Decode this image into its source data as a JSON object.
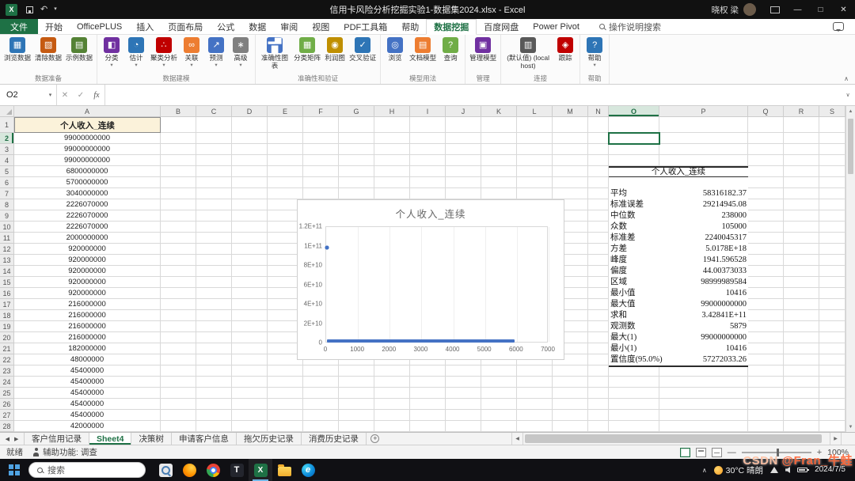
{
  "title_bar": {
    "title": "信用卡风险分析挖掘实验1-数据集2024.xlsx - Excel",
    "user": "晓权 梁"
  },
  "icons": {
    "excel": "X",
    "undo": "↶",
    "dropdown": "▾",
    "minimize": "—",
    "maximize": "□",
    "close": "✕",
    "collapse_ribbon": "∧",
    "expand_formula": "∨",
    "sheet_prev": "◀",
    "sheet_next": "▶",
    "scroll_up": "▲",
    "scroll_down": "▼",
    "scroll_left": "◀",
    "scroll_right": "▶",
    "add_sheet": "+",
    "tray_expand": "∧",
    "zoom_out": "—",
    "zoom_in": "+",
    "t_app": "T",
    "edge": "e"
  },
  "ribbon": {
    "search_placeholder": "操作说明搜索",
    "tabs": [
      {
        "label": "文件",
        "file": true
      },
      {
        "label": "开始"
      },
      {
        "label": "OfficePLUS"
      },
      {
        "label": "插入"
      },
      {
        "label": "页面布局"
      },
      {
        "label": "公式"
      },
      {
        "label": "数据"
      },
      {
        "label": "审阅"
      },
      {
        "label": "视图"
      },
      {
        "label": "PDF工具箱"
      },
      {
        "label": "帮助"
      },
      {
        "label": "数据挖掘",
        "active": true
      },
      {
        "label": "百度网盘"
      },
      {
        "label": "Power Pivot"
      }
    ],
    "groups": [
      {
        "name": "数据准备",
        "buttons": [
          {
            "key": "browse-data",
            "label": "浏览数据",
            "glyph": "▦",
            "color": "#2E75B6"
          },
          {
            "key": "clean-data",
            "label": "清除数据",
            "glyph": "▧",
            "color": "#C55A11"
          },
          {
            "key": "sample-data",
            "label": "示例数据",
            "glyph": "▤",
            "color": "#548235"
          }
        ]
      },
      {
        "name": "数据建模",
        "buttons": [
          {
            "key": "classify",
            "label": "分类",
            "glyph": "◧",
            "color": "#7030A0",
            "arrow": true
          },
          {
            "key": "estimate",
            "label": "估计",
            "glyph": "◔",
            "color": "#2E75B6",
            "arrow": true
          },
          {
            "key": "cluster",
            "label": "聚类分析",
            "glyph": "∴",
            "color": "#C00000",
            "arrow": true
          },
          {
            "key": "associate",
            "label": "关联",
            "glyph": "∞",
            "color": "#ED7D31",
            "arrow": true
          },
          {
            "key": "forecast",
            "label": "预测",
            "glyph": "↗",
            "color": "#4472C4",
            "arrow": true
          },
          {
            "key": "advanced",
            "label": "高级",
            "glyph": "∗",
            "color": "#808080",
            "arrow": true
          }
        ]
      },
      {
        "name": "准确性和验证",
        "buttons": [
          {
            "key": "accuracy-chart",
            "label": "准确性图表",
            "glyph": "▂▅▇",
            "color": "#4472C4"
          },
          {
            "key": "classification-matrix",
            "label": "分类矩阵",
            "glyph": "▦",
            "color": "#70AD47"
          },
          {
            "key": "profit-chart",
            "label": "利润图",
            "glyph": "◉",
            "color": "#BF8F00"
          },
          {
            "key": "cross-validation",
            "label": "交叉验证",
            "glyph": "✓",
            "color": "#2E75B6"
          }
        ]
      },
      {
        "name": "模型用法",
        "buttons": [
          {
            "key": "browse-model",
            "label": "浏览",
            "glyph": "◎",
            "color": "#4472C4"
          },
          {
            "key": "document-model",
            "label": "文档模型",
            "glyph": "▤",
            "color": "#ED7D31"
          },
          {
            "key": "query",
            "label": "查询",
            "glyph": "?",
            "color": "#70AD47"
          }
        ]
      },
      {
        "name": "管理",
        "buttons": [
          {
            "key": "manage-models",
            "label": "管理模型",
            "glyph": "▣",
            "color": "#7030A0"
          }
        ]
      },
      {
        "name": "连接",
        "buttons": [
          {
            "key": "connection-default",
            "label": "(默认值) (localhost)",
            "glyph": "▥",
            "color": "#595959",
            "wide": true
          },
          {
            "key": "trace",
            "label": "跟踪",
            "glyph": "◈",
            "color": "#C00000"
          }
        ]
      },
      {
        "name": "帮助",
        "buttons": [
          {
            "key": "help",
            "label": "帮助",
            "glyph": "?",
            "color": "#2E75B6",
            "arrow": true
          }
        ]
      }
    ]
  },
  "formula_bar": {
    "name_box": "O2",
    "cancel": "✕",
    "enter": "✓",
    "fx": "fx"
  },
  "grid": {
    "columns": [
      "A",
      "B",
      "C",
      "D",
      "E",
      "F",
      "G",
      "H",
      "I",
      "J",
      "K",
      "L",
      "M",
      "N",
      "O",
      "P",
      "Q",
      "R",
      "S"
    ],
    "row_headers": [
      1,
      2,
      3,
      4,
      5,
      6,
      7,
      8,
      9,
      10,
      11,
      12,
      13,
      14,
      15,
      16,
      17,
      18,
      19,
      20,
      21,
      22,
      23,
      24,
      25,
      26,
      27,
      28
    ],
    "active_cell": "O2",
    "selected_column": "O",
    "selected_row": 2,
    "a1": "个人收入_连续",
    "colA": [
      "99000000000",
      "99000000000",
      "99000000000",
      "6800000000",
      "5700000000",
      "3040000000",
      "2226070000",
      "2226070000",
      "2226070000",
      "2000000000",
      "920000000",
      "920000000",
      "920000000",
      "920000000",
      "920000000",
      "216000000",
      "216000000",
      "216000000",
      "216000000",
      "182000000",
      "48000000",
      "45400000",
      "45400000",
      "45400000",
      "45400000",
      "45400000",
      "42000000"
    ]
  },
  "stats_table": {
    "title": "个人收入_连续",
    "rows": [
      [
        "平均",
        "58316182.37"
      ],
      [
        "标准误差",
        "29214945.08"
      ],
      [
        "中位数",
        "238000"
      ],
      [
        "众数",
        "105000"
      ],
      [
        "标准差",
        "2240045317"
      ],
      [
        "方差",
        "5.0178E+18"
      ],
      [
        "峰度",
        "1941.596528"
      ],
      [
        "偏度",
        "44.00373033"
      ],
      [
        "区域",
        "98999989584"
      ],
      [
        "最小值",
        "10416"
      ],
      [
        "最大值",
        "99000000000"
      ],
      [
        "求和",
        "3.42841E+11"
      ],
      [
        "观测数",
        "5879"
      ],
      [
        "最大(1)",
        "99000000000"
      ],
      [
        "最小(1)",
        "10416"
      ],
      [
        "置信度(95.0%)",
        "57272033.26"
      ]
    ]
  },
  "chart_data": {
    "type": "scatter",
    "title": "个人收入_连续",
    "xlabel": "",
    "ylabel": "",
    "xlim": [
      0,
      7000
    ],
    "ylim": [
      0,
      120000000000
    ],
    "xticks": [
      "0",
      "1000",
      "2000",
      "3000",
      "4000",
      "5000",
      "6000",
      "7000"
    ],
    "yticks_top_to_bottom": [
      "1.2E+11",
      "1E+11",
      "8E+10",
      "6E+10",
      "4E+10",
      "2E+10",
      "0"
    ],
    "grid": "faint vertical gridlines at x ticks",
    "legend": false,
    "series": [
      {
        "name": "个人收入_连续",
        "color": "#4472C4",
        "points_summary": "约5879个收入观测值按索引绘制；绝大多数值接近0，形成从x≈0延伸到x≈5900的水平蓝色带；在x≈20附近有三个约9.9E+10的离群点",
        "outliers": [
          [
            20,
            99000000000
          ],
          [
            25,
            99000000000
          ],
          [
            30,
            99000000000
          ]
        ],
        "band": {
          "x_start": 0,
          "x_end": 5900,
          "y_min": 10416,
          "y_max": 3040000000
        }
      }
    ]
  },
  "sheet_tabs": {
    "items": [
      {
        "label": "客户信用记录"
      },
      {
        "label": "Sheet4",
        "active": true
      },
      {
        "label": "决策树"
      },
      {
        "label": "申请客户信息"
      },
      {
        "label": "拖欠历史记录"
      },
      {
        "label": "消费历史记录"
      }
    ]
  },
  "status_bar": {
    "ready": "就绪",
    "accessibility": "辅助功能: 调查",
    "zoom": "100%"
  },
  "taskbar": {
    "search": "搜索",
    "weather": "30°C 晴朗",
    "date": "2024/7/5"
  },
  "watermark": {
    "prefix": "CSDN ",
    "handle": "@Fran_牛蛙"
  }
}
